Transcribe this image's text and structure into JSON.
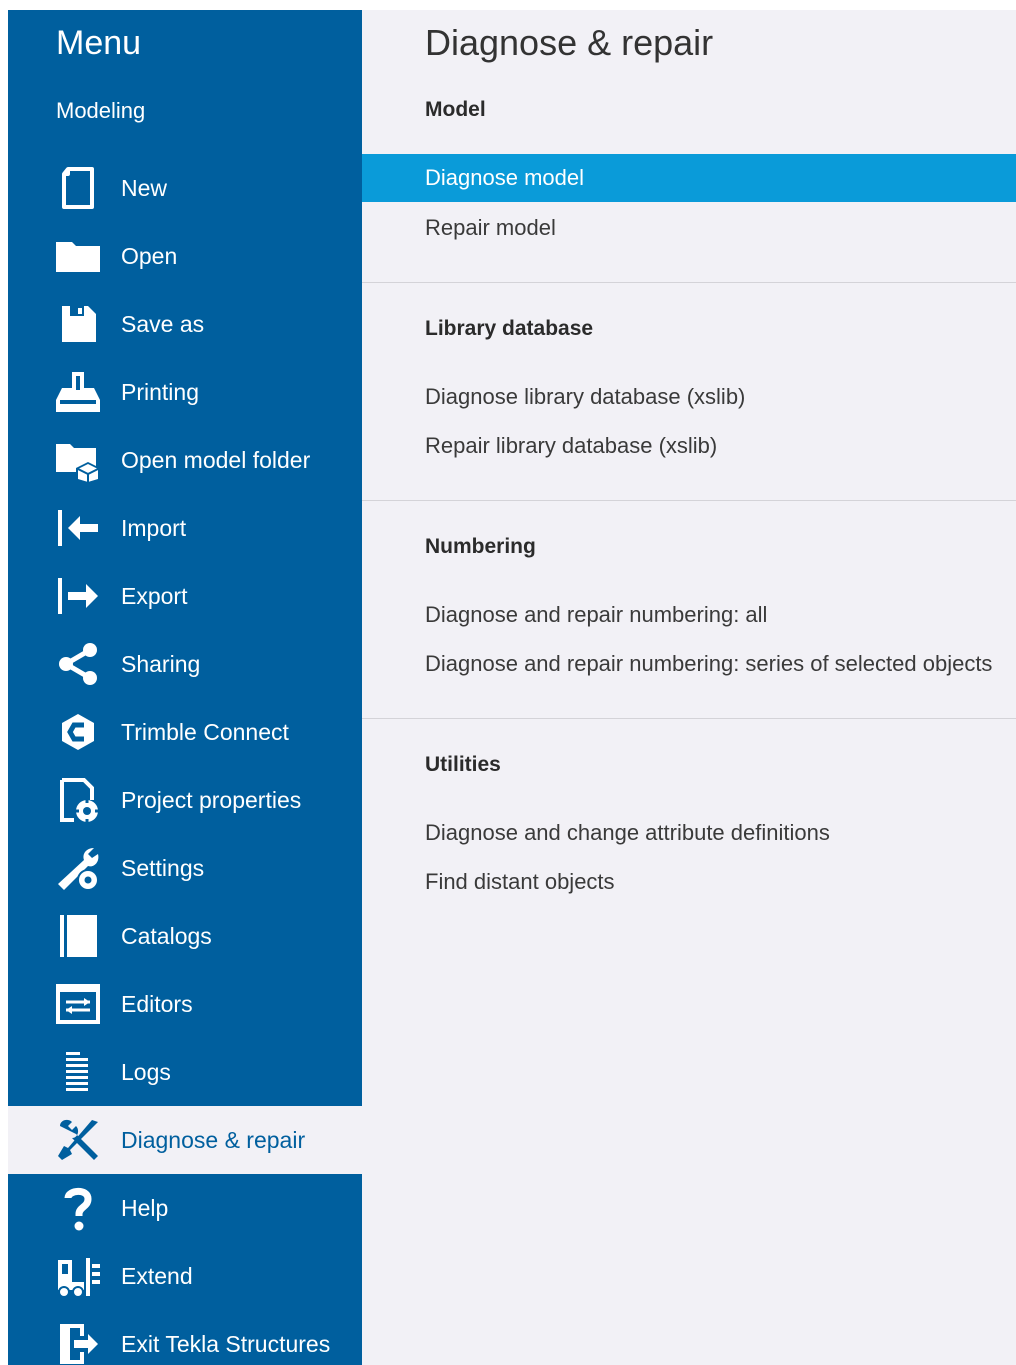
{
  "sidebar": {
    "title": "Menu",
    "subtitle": "Modeling",
    "items": [
      {
        "label": "New",
        "icon": "new-file-icon"
      },
      {
        "label": "Open",
        "icon": "folder-icon"
      },
      {
        "label": "Save as",
        "icon": "save-icon"
      },
      {
        "label": "Printing",
        "icon": "printer-icon"
      },
      {
        "label": "Open model folder",
        "icon": "model-folder-icon"
      },
      {
        "label": "Import",
        "icon": "import-icon"
      },
      {
        "label": "Export",
        "icon": "export-icon"
      },
      {
        "label": "Sharing",
        "icon": "share-icon"
      },
      {
        "label": "Trimble Connect",
        "icon": "trimble-connect-icon"
      },
      {
        "label": "Project properties",
        "icon": "project-properties-icon"
      },
      {
        "label": "Settings",
        "icon": "settings-icon"
      },
      {
        "label": "Catalogs",
        "icon": "catalog-icon"
      },
      {
        "label": "Editors",
        "icon": "editors-icon"
      },
      {
        "label": "Logs",
        "icon": "logs-icon"
      },
      {
        "label": "Diagnose & repair",
        "icon": "tools-icon",
        "active": true
      },
      {
        "label": "Help",
        "icon": "help-icon"
      },
      {
        "label": "Extend",
        "icon": "extend-icon"
      },
      {
        "label": "Exit Tekla Structures",
        "icon": "exit-icon"
      }
    ]
  },
  "main": {
    "title": "Diagnose & repair",
    "sections": [
      {
        "heading": "Model",
        "items": [
          "Diagnose model",
          "Repair model"
        ],
        "selected_index": 0
      },
      {
        "heading": "Library database",
        "items": [
          "Diagnose library database (xslib)",
          "Repair library database (xslib)"
        ]
      },
      {
        "heading": "Numbering",
        "items": [
          "Diagnose and repair numbering: all",
          "Diagnose and repair numbering: series of selected objects"
        ]
      },
      {
        "heading": "Utilities",
        "items": [
          "Diagnose and change attribute definitions",
          "Find distant objects"
        ]
      }
    ]
  },
  "colors": {
    "sidebar_bg": "#005f9e",
    "content_bg": "#f2f1f6",
    "selection": "#0a9bd9"
  }
}
